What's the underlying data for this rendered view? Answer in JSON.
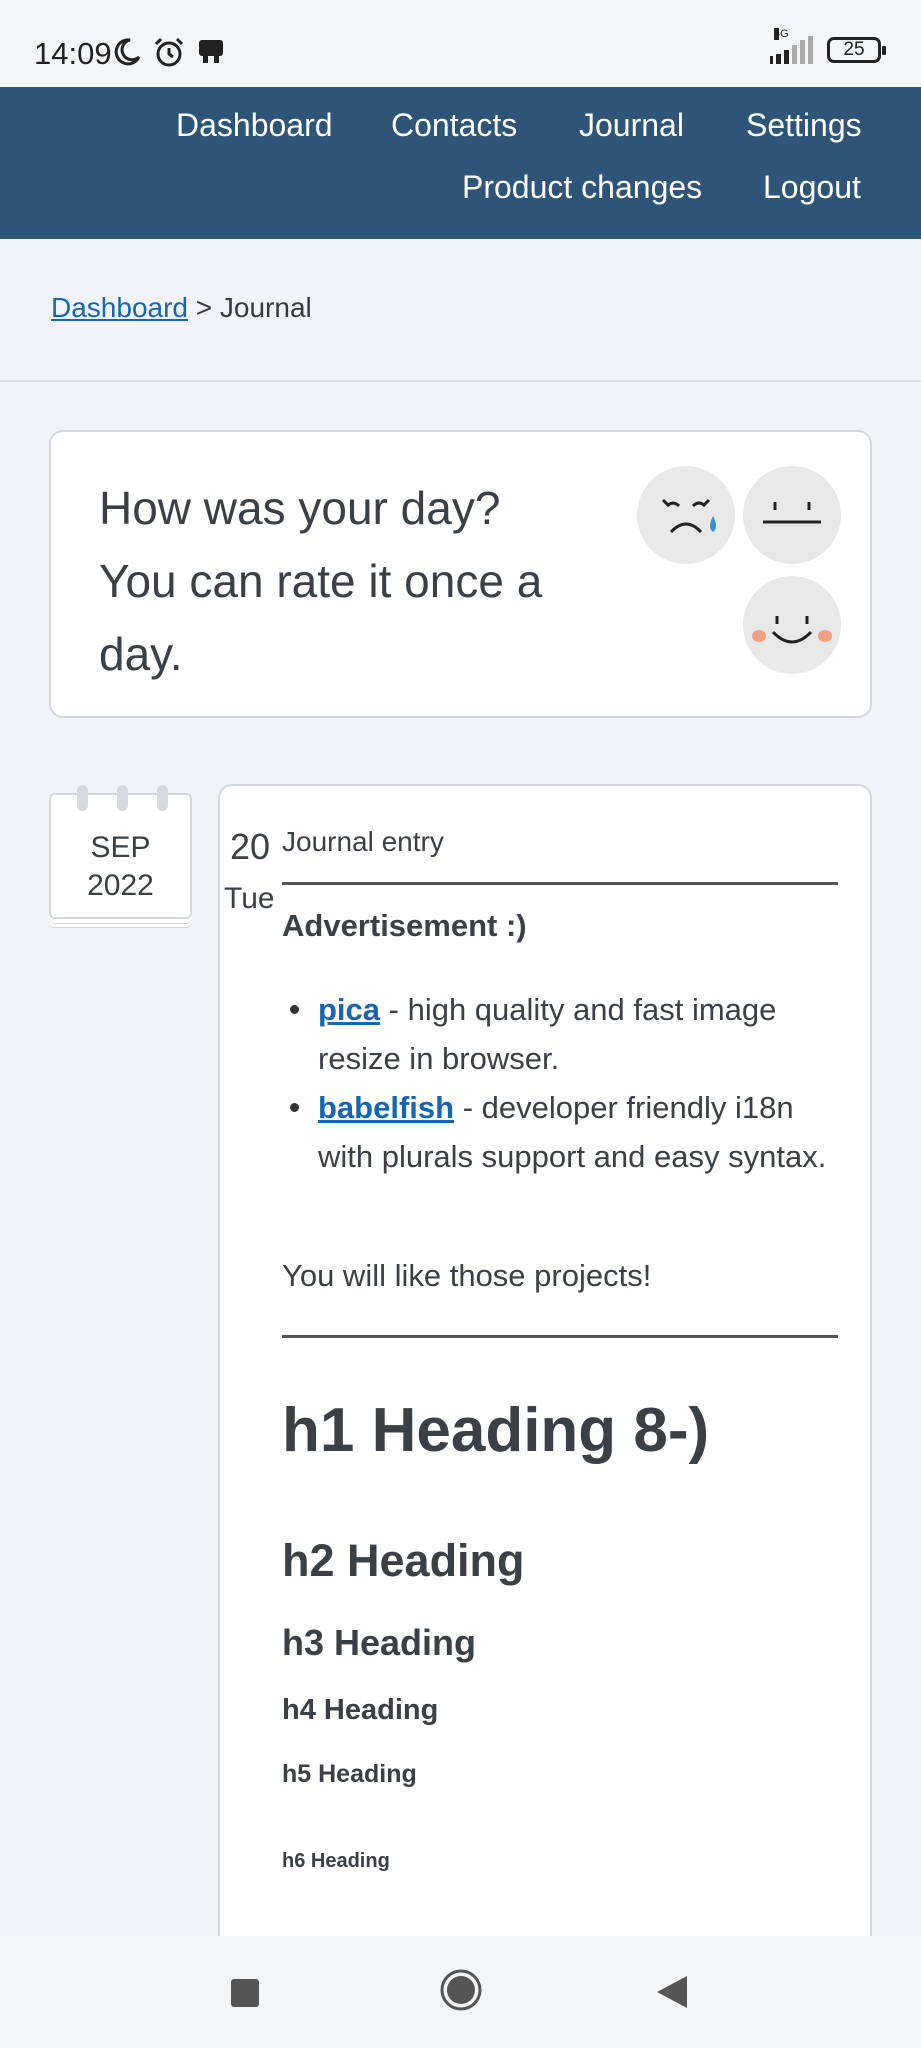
{
  "status_bar": {
    "time": "14:09",
    "network": "4G",
    "battery": "25",
    "icons": [
      "moon-icon",
      "alarm-icon",
      "notification-icon",
      "signal-icon",
      "battery-icon"
    ]
  },
  "nav": {
    "links": [
      "Dashboard",
      "Contacts",
      "Journal",
      "Settings",
      "Product changes",
      "Logout"
    ]
  },
  "breadcrumb": {
    "link": "Dashboard",
    "separator": ">",
    "current": "Journal"
  },
  "rating": {
    "question": "How was your day? You can rate it once a day.",
    "options": [
      "sad-face-icon",
      "neutral-face-icon",
      "happy-face-icon"
    ]
  },
  "entry": {
    "month": "SEP",
    "year": "2022",
    "day": "20",
    "weekday": "Tue",
    "title": "Journal entry",
    "ad_title": "Advertisement :)",
    "ad_items": [
      {
        "link": "pica",
        "text": " - high quality and fast image resize in browser."
      },
      {
        "link": "babelfish",
        "text": " - developer friendly i18n with plurals support and easy syntax."
      }
    ],
    "ad_footer": "You will like those projects!",
    "headings": {
      "h1": "h1 Heading 8-)",
      "h2": "h2 Heading",
      "h3": "h3 Heading",
      "h4": "h4 Heading",
      "h5": "h5 Heading",
      "h6": "h6 Heading"
    }
  },
  "colors": {
    "nav_bg": "#2e5578",
    "link": "#1565b5",
    "page_bg": "#f1f3f6"
  }
}
